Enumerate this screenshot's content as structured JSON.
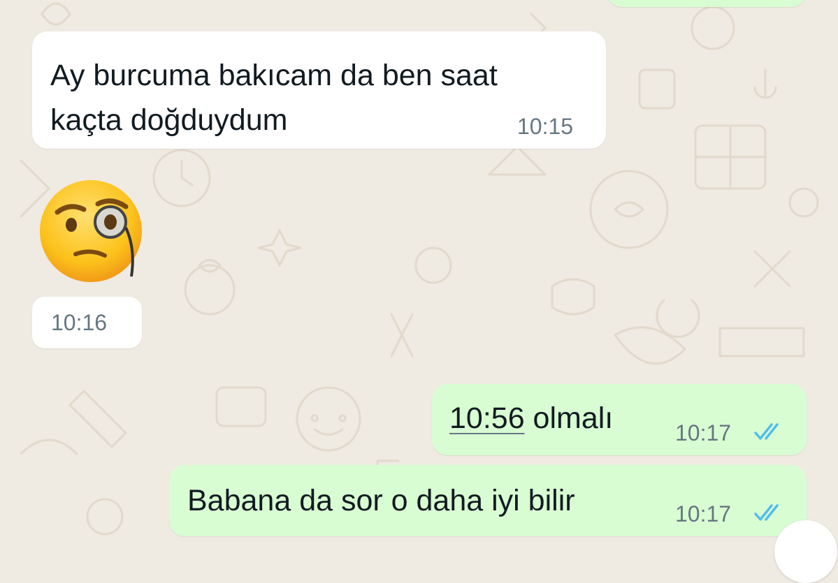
{
  "chat": {
    "colors": {
      "wallpaper": "#efeae2",
      "incoming_bubble": "#ffffff",
      "outgoing_bubble": "#d9fdd3",
      "read_ticks": "#53bdeb",
      "time_text": "#667781"
    },
    "messages": [
      {
        "direction": "incoming",
        "line1": "Ay burcuma bakıcam da ben saat",
        "line2": "kaçta doğduydum",
        "time": "10:15"
      },
      {
        "direction": "incoming",
        "emoji": "face-with-monocle-icon",
        "time": "10:16"
      },
      {
        "direction": "outgoing",
        "link_text": "10:56",
        "text": " olmalı",
        "time": "10:17",
        "status": "read-double-check-icon"
      },
      {
        "direction": "outgoing",
        "text": "Babana da sor o daha iyi bilir",
        "time": "10:17",
        "status": "read-double-check-icon"
      }
    ]
  }
}
